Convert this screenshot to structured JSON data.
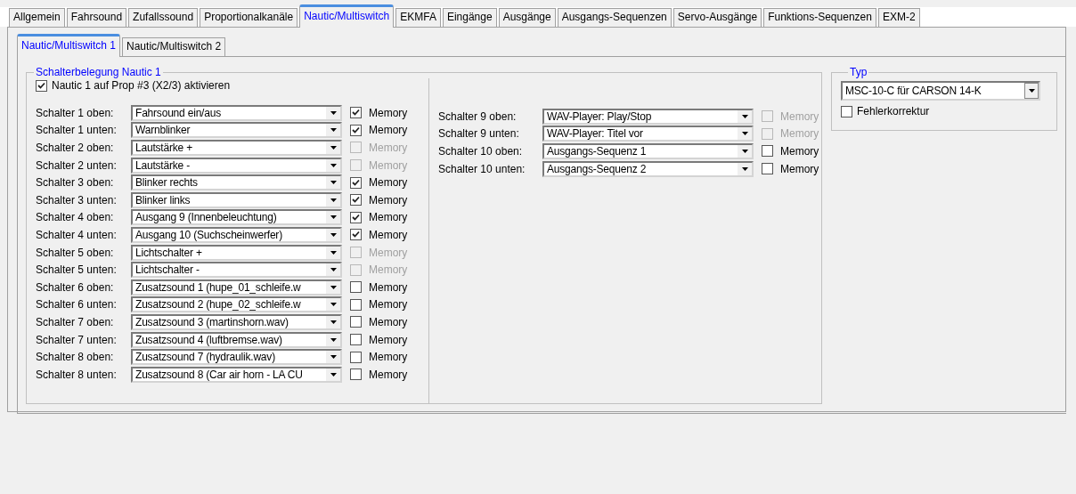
{
  "tabs": [
    {
      "label": "Allgemein",
      "selected": false
    },
    {
      "label": "Fahrsound",
      "selected": false
    },
    {
      "label": "Zufallssound",
      "selected": false
    },
    {
      "label": "Proportionalkanäle",
      "selected": false
    },
    {
      "label": "Nautic/Multiswitch",
      "selected": true
    },
    {
      "label": "EKMFA",
      "selected": false
    },
    {
      "label": "Eingänge",
      "selected": false
    },
    {
      "label": "Ausgänge",
      "selected": false
    },
    {
      "label": "Ausgangs-Sequenzen",
      "selected": false
    },
    {
      "label": "Servo-Ausgänge",
      "selected": false
    },
    {
      "label": "Funktions-Sequenzen",
      "selected": false
    },
    {
      "label": "EXM-2",
      "selected": false
    }
  ],
  "subtabs": [
    {
      "label": "Nautic/Multiswitch 1",
      "selected": true
    },
    {
      "label": "Nautic/Multiswitch 2",
      "selected": false
    }
  ],
  "group": {
    "title": "Schalterbelegung Nautic 1",
    "activate": {
      "label": "Nautic 1 auf Prop #3 (X2/3) aktivieren",
      "checked": true
    },
    "left": [
      {
        "label": "Schalter 1 oben:",
        "value": "Fahrsound ein/aus",
        "memory": {
          "label": "Memory",
          "checked": true,
          "disabled": false
        }
      },
      {
        "label": "Schalter 1 unten:",
        "value": "Warnblinker",
        "memory": {
          "label": "Memory",
          "checked": true,
          "disabled": false
        }
      },
      {
        "label": "Schalter 2 oben:",
        "value": "Lautstärke +",
        "memory": {
          "label": "Memory",
          "checked": false,
          "disabled": true
        }
      },
      {
        "label": "Schalter 2 unten:",
        "value": "Lautstärke -",
        "memory": {
          "label": "Memory",
          "checked": false,
          "disabled": true
        }
      },
      {
        "label": "Schalter 3 oben:",
        "value": "Blinker rechts",
        "memory": {
          "label": "Memory",
          "checked": true,
          "disabled": false
        }
      },
      {
        "label": "Schalter 3 unten:",
        "value": "Blinker links",
        "memory": {
          "label": "Memory",
          "checked": true,
          "disabled": false
        }
      },
      {
        "label": "Schalter 4 oben:",
        "value": "Ausgang 9 (Innenbeleuchtung)",
        "memory": {
          "label": "Memory",
          "checked": true,
          "disabled": false
        }
      },
      {
        "label": "Schalter 4 unten:",
        "value": "Ausgang 10 (Suchscheinwerfer)",
        "memory": {
          "label": "Memory",
          "checked": true,
          "disabled": false
        }
      },
      {
        "label": "Schalter 5 oben:",
        "value": "Lichtschalter +",
        "memory": {
          "label": "Memory",
          "checked": false,
          "disabled": true
        }
      },
      {
        "label": "Schalter 5 unten:",
        "value": "Lichtschalter -",
        "memory": {
          "label": "Memory",
          "checked": false,
          "disabled": true
        }
      },
      {
        "label": "Schalter 6 oben:",
        "value": "Zusatzsound 1 (hupe_01_schleife.w",
        "memory": {
          "label": "Memory",
          "checked": false,
          "disabled": false
        }
      },
      {
        "label": "Schalter 6 unten:",
        "value": "Zusatzsound 2 (hupe_02_schleife.w",
        "memory": {
          "label": "Memory",
          "checked": false,
          "disabled": false
        }
      },
      {
        "label": "Schalter 7 oben:",
        "value": "Zusatzsound 3 (martinshorn.wav)",
        "memory": {
          "label": "Memory",
          "checked": false,
          "disabled": false
        }
      },
      {
        "label": "Schalter 7 unten:",
        "value": "Zusatzsound 4 (luftbremse.wav)",
        "memory": {
          "label": "Memory",
          "checked": false,
          "disabled": false
        }
      },
      {
        "label": "Schalter 8 oben:",
        "value": "Zusatzsound 7 (hydraulik.wav)",
        "memory": {
          "label": "Memory",
          "checked": false,
          "disabled": false
        }
      },
      {
        "label": "Schalter 8 unten:",
        "value": "Zusatzsound 8 (Car air horn - LA CU",
        "memory": {
          "label": "Memory",
          "checked": false,
          "disabled": false
        }
      }
    ],
    "right": [
      {
        "label": "Schalter 9 oben:",
        "value": "WAV-Player: Play/Stop",
        "memory": {
          "label": "Memory",
          "checked": false,
          "disabled": true
        }
      },
      {
        "label": "Schalter 9 unten:",
        "value": "WAV-Player: Titel vor",
        "memory": {
          "label": "Memory",
          "checked": false,
          "disabled": true
        }
      },
      {
        "label": "Schalter 10 oben:",
        "value": "Ausgangs-Sequenz 1",
        "memory": {
          "label": "Memory",
          "checked": false,
          "disabled": false
        }
      },
      {
        "label": "Schalter 10 unten:",
        "value": "Ausgangs-Sequenz 2",
        "memory": {
          "label": "Memory",
          "checked": false,
          "disabled": false
        }
      }
    ]
  },
  "typ": {
    "title": "Typ",
    "value": "MSC-10-C für CARSON 14-K",
    "fehlerkorrektur": {
      "label": "Fehlerkorrektur",
      "checked": false
    }
  }
}
